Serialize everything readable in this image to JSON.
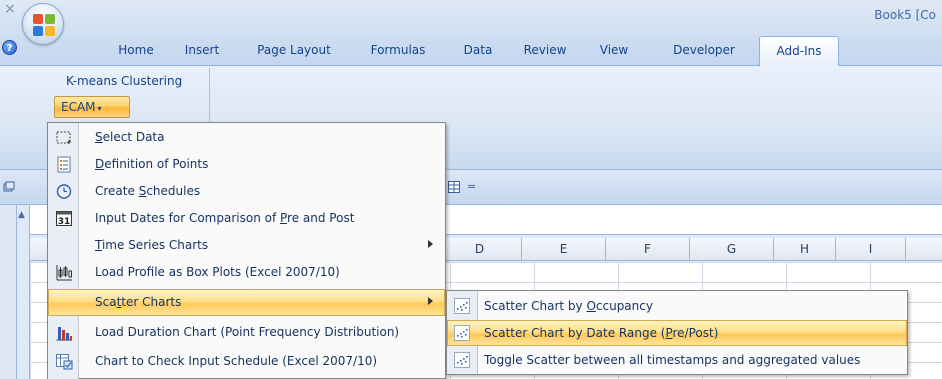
{
  "window": {
    "title": "Book5 [Co",
    "close_glyph": "×",
    "help_glyph": "?"
  },
  "tabs": [
    {
      "label": "Home"
    },
    {
      "label": "Insert"
    },
    {
      "label": "Page Layout"
    },
    {
      "label": "Formulas"
    },
    {
      "label": "Data"
    },
    {
      "label": "Review"
    },
    {
      "label": "View"
    },
    {
      "label": "Developer"
    },
    {
      "label": "Add-Ins",
      "active": true
    }
  ],
  "ribbon": {
    "group_label": "K-means Clustering",
    "ecam_button": "ECAM",
    "ecam_arrow": "▾"
  },
  "quick_access": {
    "arrow": "="
  },
  "columns": [
    "D",
    "E",
    "F",
    "G",
    "H",
    "I"
  ],
  "menu": {
    "items": [
      {
        "icon": "select-data-icon",
        "pre": "",
        "accel": "S",
        "post": "elect Data",
        "submenu": false
      },
      {
        "icon": "points-list-icon",
        "pre": "",
        "accel": "D",
        "post": "efinition of Points",
        "submenu": false
      },
      {
        "icon": "clock-icon",
        "pre": "Create ",
        "accel": "S",
        "post": "chedules",
        "submenu": false
      },
      {
        "icon": "calendar-31-icon",
        "pre": "Input Dates for Comparison of ",
        "accel": "P",
        "post": "re and Post",
        "submenu": false
      },
      {
        "icon": "",
        "pre": "",
        "accel": "T",
        "post": "ime Series Charts",
        "submenu": true
      },
      {
        "icon": "box-plot-icon",
        "pre": "Load Profile as Box Plots (Excel 2007/10)",
        "accel": "",
        "post": "",
        "submenu": false
      },
      {
        "icon": "",
        "pre": "Sca",
        "accel": "t",
        "post": "ter Charts",
        "submenu": true,
        "highlighted": true
      },
      {
        "icon": "bar-chart-icon",
        "pre": "Load Duration Chart (Point Frequency Distribution)",
        "accel": "",
        "post": "",
        "submenu": false
      },
      {
        "icon": "schedule-check-icon",
        "pre": "Chart to Check Input Schedule (Excel 2007/10)",
        "accel": "",
        "post": "",
        "submenu": false
      }
    ]
  },
  "submenu": {
    "items": [
      {
        "icon": "scatter-icon",
        "pre": "Scatter Chart by ",
        "accel": "O",
        "post": "ccupancy"
      },
      {
        "icon": "scatter-icon",
        "pre": "Scatter Chart by Date Range (",
        "accel": "P",
        "post": "re/Post)",
        "highlighted": true
      },
      {
        "icon": "scatter-icon",
        "pre": "Toggle Scatter between all timestamps and aggregated values",
        "accel": "",
        "post": ""
      }
    ]
  }
}
